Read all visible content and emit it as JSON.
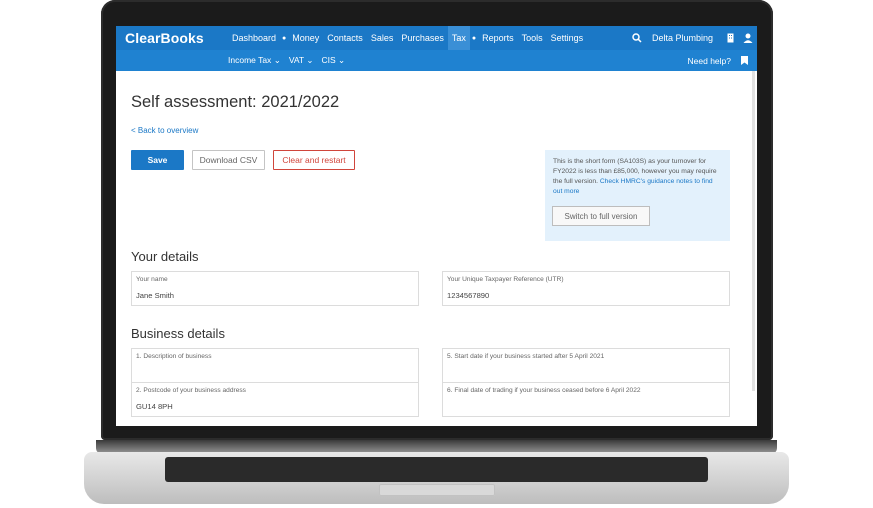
{
  "nav": {
    "brand": "ClearBooks",
    "links": [
      "Dashboard",
      "Money",
      "Contacts",
      "Sales",
      "Purchases",
      "Tax",
      "Reports",
      "Tools",
      "Settings"
    ],
    "company": "Delta Plumbing"
  },
  "subnav": {
    "links": [
      "Income Tax",
      "VAT",
      "CIS"
    ],
    "help": "Need help?"
  },
  "page": {
    "title": "Self assessment: 2021/2022",
    "back": "< Back to overview"
  },
  "buttons": {
    "save": "Save",
    "csv": "Download CSV",
    "clear": "Clear and restart",
    "switch": "Switch to full version"
  },
  "info": {
    "text": "This is the short form (SA103S) as your turnover for FY2022 is less than £85,000, however you may require the full version.",
    "link": "Check HMRC's guidance notes to find out more"
  },
  "your_details": {
    "title": "Your details",
    "name_label": "Your name",
    "name_value": "Jane Smith",
    "utr_label": "Your Unique Taxpayer Reference (UTR)",
    "utr_value": "1234567890"
  },
  "business_details": {
    "title": "Business details",
    "f1_label": "1. Description of business",
    "f5_label": "5. Start date if your business started after 5 April 2021",
    "f2_label": "2. Postcode of your business address",
    "f2_value": "GU14 8PH",
    "f6_label": "6. Final date of trading if your business ceased before 6 April 2022"
  }
}
